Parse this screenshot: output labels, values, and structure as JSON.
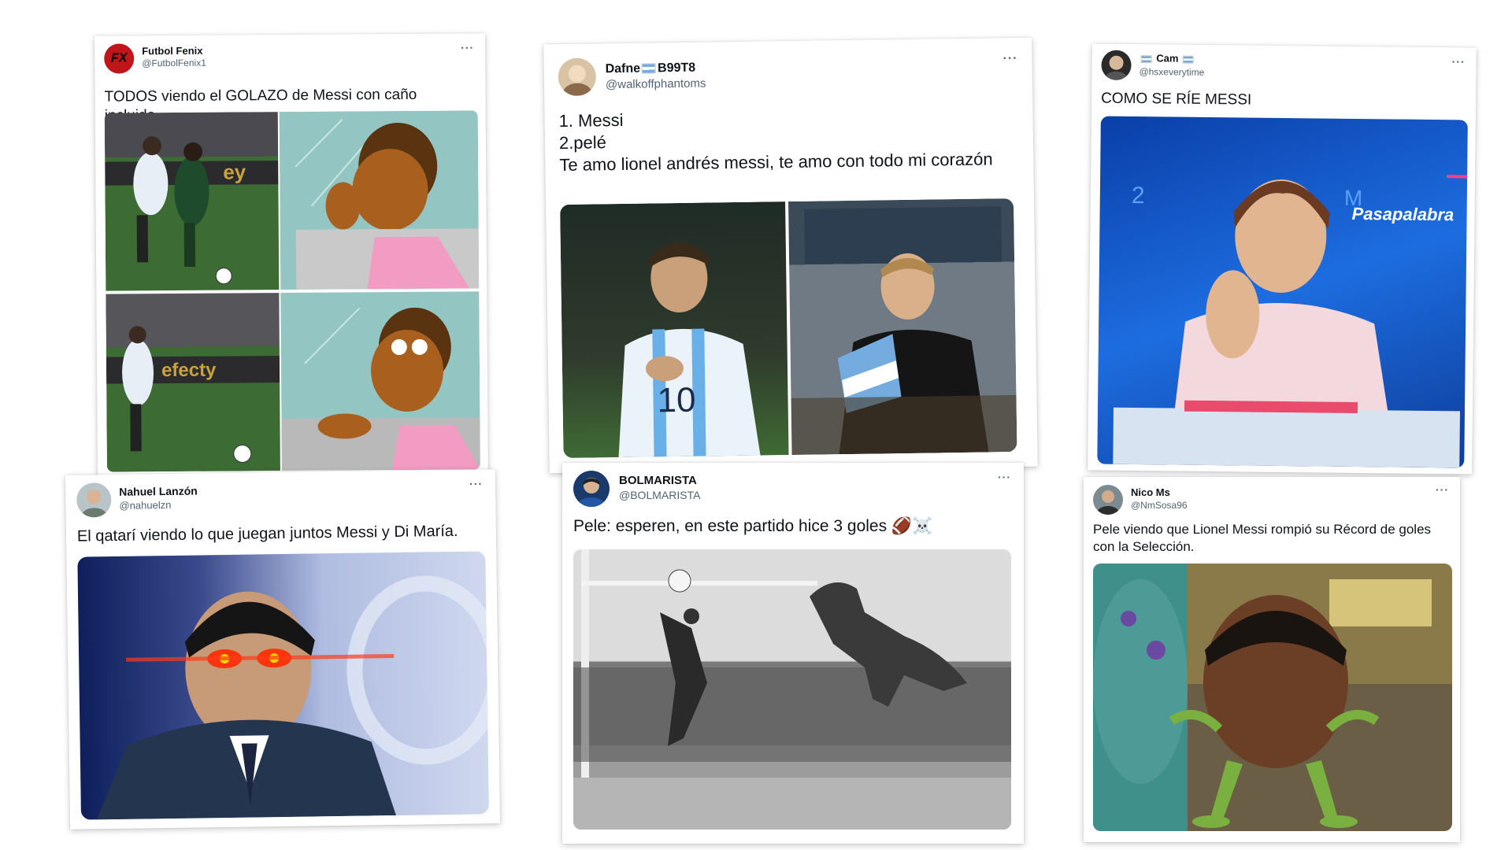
{
  "tweets": [
    {
      "name": "Futbol Fenix",
      "handle": "@FutbolFenix1",
      "text": "TODOS viendo el GOLAZO de Messi con caño incluido.",
      "avatar_text": "FX"
    },
    {
      "name": "Dafne",
      "name_suffix": "B99T8",
      "handle": "@walkoffphantoms",
      "text": "1. Messi\n2.pelé\nTe amo lionel andrés messi, te amo con todo mi corazón"
    },
    {
      "name": "Cam",
      "handle": "@hsxeverytime",
      "text": "COMO SE RÍE MESSI",
      "media_caption": "Pasapalabra"
    },
    {
      "name": "Nahuel Lanzón",
      "handle": "@nahuelzn",
      "text": "El qatarí viendo lo que juegan juntos Messi y Di María."
    },
    {
      "name": "BOLMARISTA",
      "handle": "@BOLMARISTA",
      "text": "Pele: esperen, en este partido hice 3 goles 🏈☠️"
    },
    {
      "name": "Nico Ms",
      "handle": "@NmSosa96",
      "text": "Pele viendo que Lionel Messi rompió su Récord de goles con la Selección."
    }
  ],
  "more_label": "···",
  "icons": {
    "more": "more-dots-icon",
    "flag": "argentina-flag-icon"
  }
}
